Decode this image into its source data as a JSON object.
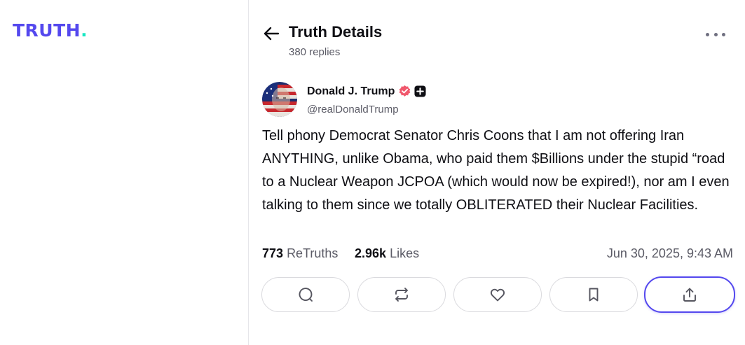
{
  "brand": {
    "wordmark": "TRUTH",
    "wordmark_dot": ".",
    "color": "#5448ee",
    "dot_color": "#17e7c2"
  },
  "header": {
    "title": "Truth Details",
    "replies": "380 replies",
    "back_icon": "arrow-left-icon",
    "more_icon": "more-horizontal-icon"
  },
  "post": {
    "author": {
      "name": "Donald J. Trump",
      "handle": "@realDonaldTrump",
      "verified_color": "#f0586d",
      "badges": [
        "verified-badge-icon",
        "plus-badge-icon"
      ]
    },
    "text": "Tell phony Democrat Senator Chris Coons that I am not offering Iran ANYTHING, unlike Obama, who paid them $Billions under the stupid “road to a Nuclear Weapon JCPOA (which would now be expired!), nor am I even talking to them since we totally OBLITERATED their Nuclear Facilities.",
    "stats": {
      "retruths_count": "773",
      "retruths_label": "ReTruths",
      "likes_count": "2.96k",
      "likes_label": "Likes"
    },
    "timestamp": "Jun 30, 2025, 9:43 AM"
  },
  "actions": [
    {
      "name": "reply",
      "icon": "comment-icon"
    },
    {
      "name": "retruth",
      "icon": "repost-icon"
    },
    {
      "name": "like",
      "icon": "heart-icon"
    },
    {
      "name": "bookmark",
      "icon": "bookmark-icon"
    },
    {
      "name": "share",
      "icon": "share-icon",
      "active": true
    }
  ],
  "colors": {
    "accent": "#5448ee",
    "text_primary": "#0f0f14",
    "text_secondary": "#5b5b66",
    "border": "#dadade"
  }
}
